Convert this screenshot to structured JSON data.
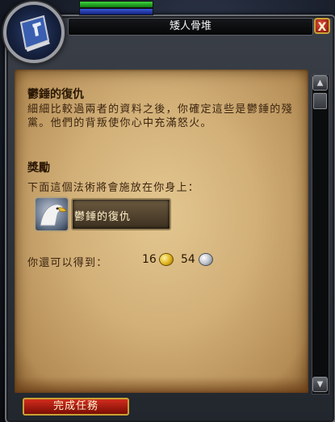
{
  "window": {
    "title": "矮人骨堆",
    "close_label": "X"
  },
  "quest": {
    "title": "鬱錘的復仇",
    "description": "細細比較過兩者的資料之後，你確定這些是鬱錘的殘黨。他們的背叛使你心中充滿怒火。"
  },
  "rewards": {
    "header": "獎勵",
    "spell_line": "下面這個法術將會施放在你身上：",
    "item": {
      "name": "鬱錘的復仇",
      "icon": "eagle-head-icon"
    },
    "money_label": "你還可以得到：",
    "gold": "16",
    "silver": "54",
    "gold_icon": "gold-coin-icon",
    "silver_icon": "silver-coin-icon"
  },
  "footer": {
    "complete_label": "完成任務"
  },
  "scrollbar": {
    "up_glyph": "▲",
    "down_glyph": "▼"
  },
  "colors": {
    "parchment": "#d2b078",
    "button_red": "#b81d10",
    "gold_trim": "#c9a233"
  }
}
